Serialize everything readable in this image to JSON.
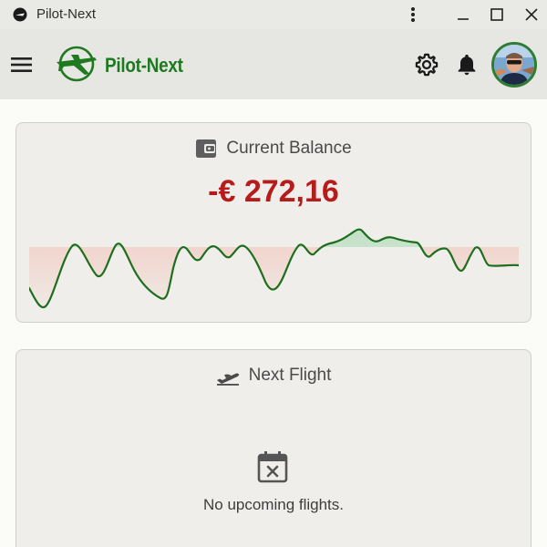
{
  "window": {
    "title": "Pilot-Next",
    "icons": [
      "app-icon",
      "more-vert-icon",
      "minimize-icon",
      "maximize-icon",
      "close-icon"
    ]
  },
  "header": {
    "brand": "Pilot-Next",
    "icons": [
      "menu-icon",
      "airplane-logo-icon",
      "gear-icon",
      "bell-icon"
    ]
  },
  "balance": {
    "title": "Current Balance",
    "amount": "-€ 272,16",
    "amount_color": "#b71c1c",
    "icon": "wallet-icon"
  },
  "next_flight": {
    "title": "Next Flight",
    "empty_text": "No upcoming flights.",
    "icon": "flight-takeoff-icon",
    "empty_icon": "calendar-remove-icon"
  },
  "colors": {
    "brand_green": "#1f7a1f",
    "line_green": "#1e6e1e",
    "negative_fill": "#f3d4cd",
    "positive_fill": "#c9e2cd"
  }
}
